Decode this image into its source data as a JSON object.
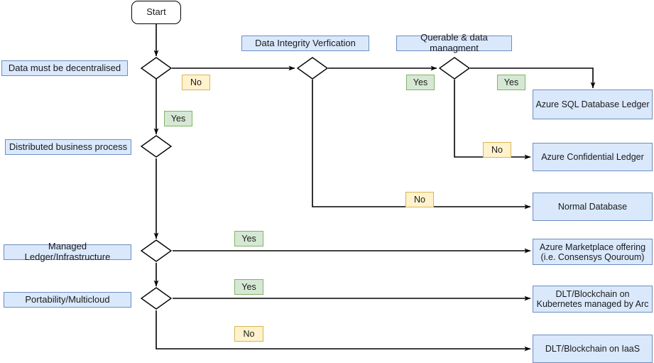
{
  "diagram": {
    "title": "Azure ledger / blockchain decision flowchart",
    "colors": {
      "process_fill": "#dae8fc",
      "process_stroke": "#6c8ebf",
      "yes_fill": "#d5e8d4",
      "yes_stroke": "#82b366",
      "no_fill": "#fff2cc",
      "no_stroke": "#d6b656",
      "edge_stroke": "#000000",
      "background": "#ffffff"
    }
  },
  "start": {
    "label": "Start"
  },
  "decisions": [
    {
      "id": "decentralised",
      "label": "Data must be decentralised"
    },
    {
      "id": "distributed-business-process",
      "label": "Distributed business process"
    },
    {
      "id": "managed-ledger",
      "label": "Managed Ledger/Infrastructure"
    },
    {
      "id": "portability",
      "label": "Portability/Multicloud"
    },
    {
      "id": "data-integrity",
      "label": "Data Integrity Verfication"
    },
    {
      "id": "querable",
      "label": "Querable & data managment"
    }
  ],
  "outcomes": [
    {
      "id": "azure-sql-database-ledger",
      "label": "Azure SQL Database Ledger"
    },
    {
      "id": "azure-confidential-ledger",
      "label": "Azure Confidential Ledger"
    },
    {
      "id": "normal-database",
      "label": "Normal Database"
    },
    {
      "id": "azure-marketplace-offering",
      "label": "Azure Marketplace offering (i.e. Consensys Qouroum)"
    },
    {
      "id": "dlt-blockchain-kubernetes",
      "label": "DLT/Blockchain on Kubernetes managed by Arc"
    },
    {
      "id": "dlt-blockchain-iaas",
      "label": "DLT/Blockchain on IaaS"
    }
  ],
  "edge_labels": {
    "decentralised_no": "No",
    "decentralised_yes": "Yes",
    "data_integrity_yes": "Yes",
    "data_integrity_no": "No",
    "querable_yes": "Yes",
    "querable_no": "No",
    "managed_ledger_yes": "Yes",
    "portability_yes": "Yes",
    "portability_no": "No"
  }
}
